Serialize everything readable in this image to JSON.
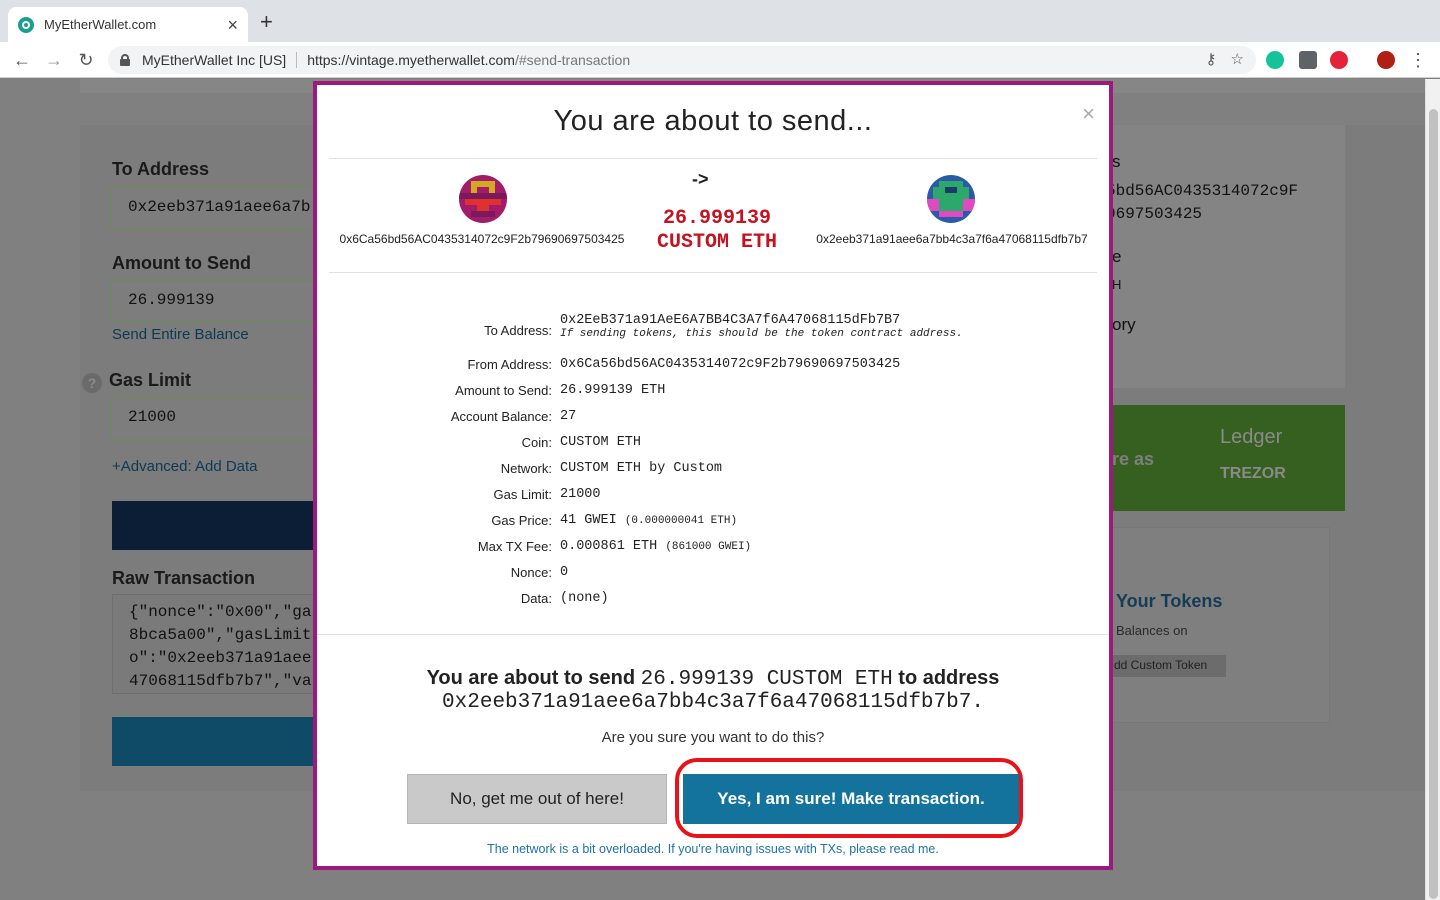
{
  "browser": {
    "tab_title": "MyEtherWallet.com",
    "tab_close": "×",
    "new_tab": "+",
    "back": "←",
    "forward": "→",
    "reload": "↻",
    "org": "MyEtherWallet Inc [US]",
    "url_host": "https://vintage.myetherwallet.com",
    "url_path": "/#send-transaction",
    "omni_icons": [
      "key-icon",
      "star-icon"
    ],
    "extensions": [
      "grammarly-icon",
      "extension-icon",
      "adblock-icon",
      "profile-avatar-icon",
      "menu-icon"
    ]
  },
  "background_form": {
    "to_address_label": "To Address",
    "to_address_value": "0x2eeb371a91aee6a7b",
    "amount_label": "Amount to Send",
    "amount_value": "26.999139",
    "send_entire_balance": "Send Entire Balance",
    "gas_limit_label": "Gas Limit",
    "gas_limit_value": "21000",
    "help_icon": "?",
    "advanced_link": "+Advanced: Add Data",
    "raw_label": "Raw Transaction",
    "raw_lines": "{\"nonce\":\"0x00\",\"ga\n8bca5a00\",\"gasLimit\no\":\"0x2eeb371a91aee\n47068115dfb7b7\",\"va",
    "right_partial": {
      "line1": "s",
      "line2": "5bd56AC0435314072c9F",
      "line3": "0697503425",
      "line4": "e",
      "line5": "H",
      "line6": "ory"
    },
    "banner_text": "re as",
    "ledger": "Ledger",
    "trezor": "TREZOR",
    "tokens_title": "Your Tokens",
    "tokens_sub": "Balances on",
    "add_custom_token": "dd Custom Token"
  },
  "modal": {
    "title": "You are about to send...",
    "close": "×",
    "arrow": "->",
    "from_address_short": "0x6Ca56bd56AC0435314072c9F2b79690697503425",
    "to_address_short": "0x2eeb371a91aee6a7bb4c3a7f6a47068115dfb7b7",
    "amount_big": "26.999139",
    "unit_big": "CUSTOM ETH",
    "details": [
      {
        "label": "To Address:",
        "value": "0x2EeB371a91AeE6A7BB4C3A7f6A47068115dFb7B7",
        "note": "If sending tokens, this should be the token contract address."
      },
      {
        "label": "From Address:",
        "value": "0x6Ca56bd56AC0435314072c9F2b79690697503425"
      },
      {
        "label": "Amount to Send:",
        "value": "26.999139 ETH"
      },
      {
        "label": "Account Balance:",
        "value": "27"
      },
      {
        "label": "Coin:",
        "value": "CUSTOM ETH"
      },
      {
        "label": "Network:",
        "value": "CUSTOM ETH by Custom"
      },
      {
        "label": "Gas Limit:",
        "value": "21000"
      },
      {
        "label": "Gas Price:",
        "value": "41 GWEI",
        "small": "(0.000000041 ETH)"
      },
      {
        "label": "Max TX Fee:",
        "value": "0.000861 ETH",
        "small": "(861000 GWEI)"
      },
      {
        "label": "Nonce:",
        "value": "0"
      },
      {
        "label": "Data:",
        "value": "(none)"
      }
    ],
    "confirm_prefix": "You are about to send",
    "confirm_amount": "26.999139 CUSTOM ETH",
    "confirm_mid": "to address",
    "confirm_address": "0x2eeb371a91aee6a7bb4c3a7f6a47068115dfb7b7.",
    "question": "Are you sure you want to do this?",
    "no_button": "No, get me out of here!",
    "yes_button": "Yes, I am sure! Make transaction.",
    "network_note": "The network is a bit overloaded. If you're having issues with TXs, please read me."
  },
  "colors": {
    "modal_border": "#9c1a7c",
    "amount_red": "#c4121e",
    "yes_blue": "#13739c",
    "highlight_red": "#e8121b"
  }
}
